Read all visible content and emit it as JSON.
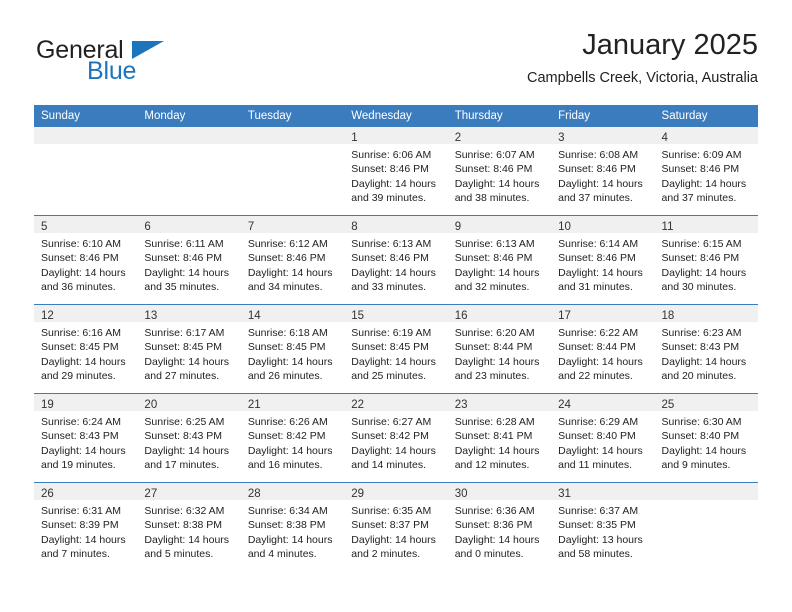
{
  "brand": {
    "name_part1": "General",
    "name_part2": "Blue",
    "accent_color": "#1c75bc"
  },
  "header": {
    "month_title": "January 2025",
    "location": "Campbells Creek, Victoria, Australia"
  },
  "theme": {
    "header_blue": "#3b7cbf",
    "daynum_band": "#f0f0f0"
  },
  "weekday_headers": [
    "Sunday",
    "Monday",
    "Tuesday",
    "Wednesday",
    "Thursday",
    "Friday",
    "Saturday"
  ],
  "weeks": [
    [
      {
        "day": "",
        "lines": []
      },
      {
        "day": "",
        "lines": []
      },
      {
        "day": "",
        "lines": []
      },
      {
        "day": "1",
        "lines": [
          "Sunrise: 6:06 AM",
          "Sunset: 8:46 PM",
          "Daylight: 14 hours",
          "and 39 minutes."
        ]
      },
      {
        "day": "2",
        "lines": [
          "Sunrise: 6:07 AM",
          "Sunset: 8:46 PM",
          "Daylight: 14 hours",
          "and 38 minutes."
        ]
      },
      {
        "day": "3",
        "lines": [
          "Sunrise: 6:08 AM",
          "Sunset: 8:46 PM",
          "Daylight: 14 hours",
          "and 37 minutes."
        ]
      },
      {
        "day": "4",
        "lines": [
          "Sunrise: 6:09 AM",
          "Sunset: 8:46 PM",
          "Daylight: 14 hours",
          "and 37 minutes."
        ]
      }
    ],
    [
      {
        "day": "5",
        "lines": [
          "Sunrise: 6:10 AM",
          "Sunset: 8:46 PM",
          "Daylight: 14 hours",
          "and 36 minutes."
        ]
      },
      {
        "day": "6",
        "lines": [
          "Sunrise: 6:11 AM",
          "Sunset: 8:46 PM",
          "Daylight: 14 hours",
          "and 35 minutes."
        ]
      },
      {
        "day": "7",
        "lines": [
          "Sunrise: 6:12 AM",
          "Sunset: 8:46 PM",
          "Daylight: 14 hours",
          "and 34 minutes."
        ]
      },
      {
        "day": "8",
        "lines": [
          "Sunrise: 6:13 AM",
          "Sunset: 8:46 PM",
          "Daylight: 14 hours",
          "and 33 minutes."
        ]
      },
      {
        "day": "9",
        "lines": [
          "Sunrise: 6:13 AM",
          "Sunset: 8:46 PM",
          "Daylight: 14 hours",
          "and 32 minutes."
        ]
      },
      {
        "day": "10",
        "lines": [
          "Sunrise: 6:14 AM",
          "Sunset: 8:46 PM",
          "Daylight: 14 hours",
          "and 31 minutes."
        ]
      },
      {
        "day": "11",
        "lines": [
          "Sunrise: 6:15 AM",
          "Sunset: 8:46 PM",
          "Daylight: 14 hours",
          "and 30 minutes."
        ]
      }
    ],
    [
      {
        "day": "12",
        "lines": [
          "Sunrise: 6:16 AM",
          "Sunset: 8:45 PM",
          "Daylight: 14 hours",
          "and 29 minutes."
        ]
      },
      {
        "day": "13",
        "lines": [
          "Sunrise: 6:17 AM",
          "Sunset: 8:45 PM",
          "Daylight: 14 hours",
          "and 27 minutes."
        ]
      },
      {
        "day": "14",
        "lines": [
          "Sunrise: 6:18 AM",
          "Sunset: 8:45 PM",
          "Daylight: 14 hours",
          "and 26 minutes."
        ]
      },
      {
        "day": "15",
        "lines": [
          "Sunrise: 6:19 AM",
          "Sunset: 8:45 PM",
          "Daylight: 14 hours",
          "and 25 minutes."
        ]
      },
      {
        "day": "16",
        "lines": [
          "Sunrise: 6:20 AM",
          "Sunset: 8:44 PM",
          "Daylight: 14 hours",
          "and 23 minutes."
        ]
      },
      {
        "day": "17",
        "lines": [
          "Sunrise: 6:22 AM",
          "Sunset: 8:44 PM",
          "Daylight: 14 hours",
          "and 22 minutes."
        ]
      },
      {
        "day": "18",
        "lines": [
          "Sunrise: 6:23 AM",
          "Sunset: 8:43 PM",
          "Daylight: 14 hours",
          "and 20 minutes."
        ]
      }
    ],
    [
      {
        "day": "19",
        "lines": [
          "Sunrise: 6:24 AM",
          "Sunset: 8:43 PM",
          "Daylight: 14 hours",
          "and 19 minutes."
        ]
      },
      {
        "day": "20",
        "lines": [
          "Sunrise: 6:25 AM",
          "Sunset: 8:43 PM",
          "Daylight: 14 hours",
          "and 17 minutes."
        ]
      },
      {
        "day": "21",
        "lines": [
          "Sunrise: 6:26 AM",
          "Sunset: 8:42 PM",
          "Daylight: 14 hours",
          "and 16 minutes."
        ]
      },
      {
        "day": "22",
        "lines": [
          "Sunrise: 6:27 AM",
          "Sunset: 8:42 PM",
          "Daylight: 14 hours",
          "and 14 minutes."
        ]
      },
      {
        "day": "23",
        "lines": [
          "Sunrise: 6:28 AM",
          "Sunset: 8:41 PM",
          "Daylight: 14 hours",
          "and 12 minutes."
        ]
      },
      {
        "day": "24",
        "lines": [
          "Sunrise: 6:29 AM",
          "Sunset: 8:40 PM",
          "Daylight: 14 hours",
          "and 11 minutes."
        ]
      },
      {
        "day": "25",
        "lines": [
          "Sunrise: 6:30 AM",
          "Sunset: 8:40 PM",
          "Daylight: 14 hours",
          "and 9 minutes."
        ]
      }
    ],
    [
      {
        "day": "26",
        "lines": [
          "Sunrise: 6:31 AM",
          "Sunset: 8:39 PM",
          "Daylight: 14 hours",
          "and 7 minutes."
        ]
      },
      {
        "day": "27",
        "lines": [
          "Sunrise: 6:32 AM",
          "Sunset: 8:38 PM",
          "Daylight: 14 hours",
          "and 5 minutes."
        ]
      },
      {
        "day": "28",
        "lines": [
          "Sunrise: 6:34 AM",
          "Sunset: 8:38 PM",
          "Daylight: 14 hours",
          "and 4 minutes."
        ]
      },
      {
        "day": "29",
        "lines": [
          "Sunrise: 6:35 AM",
          "Sunset: 8:37 PM",
          "Daylight: 14 hours",
          "and 2 minutes."
        ]
      },
      {
        "day": "30",
        "lines": [
          "Sunrise: 6:36 AM",
          "Sunset: 8:36 PM",
          "Daylight: 14 hours",
          "and 0 minutes."
        ]
      },
      {
        "day": "31",
        "lines": [
          "Sunrise: 6:37 AM",
          "Sunset: 8:35 PM",
          "Daylight: 13 hours",
          "and 58 minutes."
        ]
      },
      {
        "day": "",
        "lines": []
      }
    ]
  ]
}
